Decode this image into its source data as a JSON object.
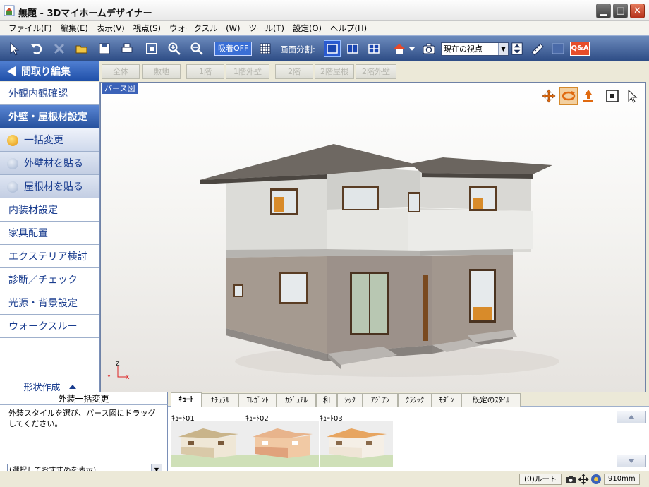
{
  "window": {
    "title": "無題 - 3Dマイホームデザイナー"
  },
  "menu": [
    "ファイル(F)",
    "編集(E)",
    "表示(V)",
    "視点(S)",
    "ウォークスルー(W)",
    "ツール(T)",
    "設定(O)",
    "ヘルプ(H)"
  ],
  "toolbar": {
    "snap_label": "吸着OFF",
    "split_label": "画面分割:",
    "viewpoint_value": "現在の視点",
    "qa_label": "Q&A"
  },
  "left_panel": {
    "back_label": "間取り編集",
    "items": [
      {
        "label": "外観内観確認"
      },
      {
        "label": "外壁・屋根材設定"
      },
      {
        "label": "一括変更"
      },
      {
        "label": "外壁材を貼る"
      },
      {
        "label": "屋根材を貼る"
      },
      {
        "label": "内装材設定"
      },
      {
        "label": "家具配置"
      },
      {
        "label": "エクステリア検討"
      },
      {
        "label": "診断／チェック"
      },
      {
        "label": "光源・背景設定"
      },
      {
        "label": "ウォークスルー"
      }
    ],
    "shape_make_label": "形状作成"
  },
  "floor_tabs": [
    "全体",
    "敷地",
    "1階",
    "1階外壁",
    "2階",
    "2階屋根",
    "2階外壁"
  ],
  "viewport": {
    "label": "パース図",
    "axis_z": "Z",
    "axis_y": "Y",
    "axis_x": "X"
  },
  "bulk": {
    "title": "外装一括変更",
    "description": "外装スタイルを選び、パース図にドラッグしてください。",
    "select_value": "(選択しておすすめを表示)"
  },
  "style_tabs": [
    "ｷｭｰﾄ",
    "ﾅﾁｭﾗﾙ",
    "ｴﾚｶﾞﾝﾄ",
    "ｶｼﾞｭｱﾙ",
    "和",
    "ｼｯｸ",
    "ｱｼﾞｱﾝ",
    "ｸﾗｼｯｸ",
    "ﾓﾀﾞﾝ",
    "既定のｽﾀｲﾙ"
  ],
  "thumbnails": [
    {
      "label": "ｷｭｰﾄ01",
      "wall": "#efe7d6",
      "base": "#d9c9a8",
      "roof": "#c9b48a"
    },
    {
      "label": "ｷｭｰﾄ02",
      "wall": "#f1c9a4",
      "base": "#e0a27c",
      "roof": "#e8b48c"
    },
    {
      "label": "ｷｭｰﾄ03",
      "wall": "#f5efe6",
      "base": "#efe5d6",
      "roof": "#e7a560"
    }
  ],
  "status": {
    "route_count": "(0)ルート",
    "grid_size": "910mm"
  },
  "colors": {
    "toolbar": "#2e4d86",
    "nav_active": "#27529e",
    "accent": "#e3900a"
  }
}
